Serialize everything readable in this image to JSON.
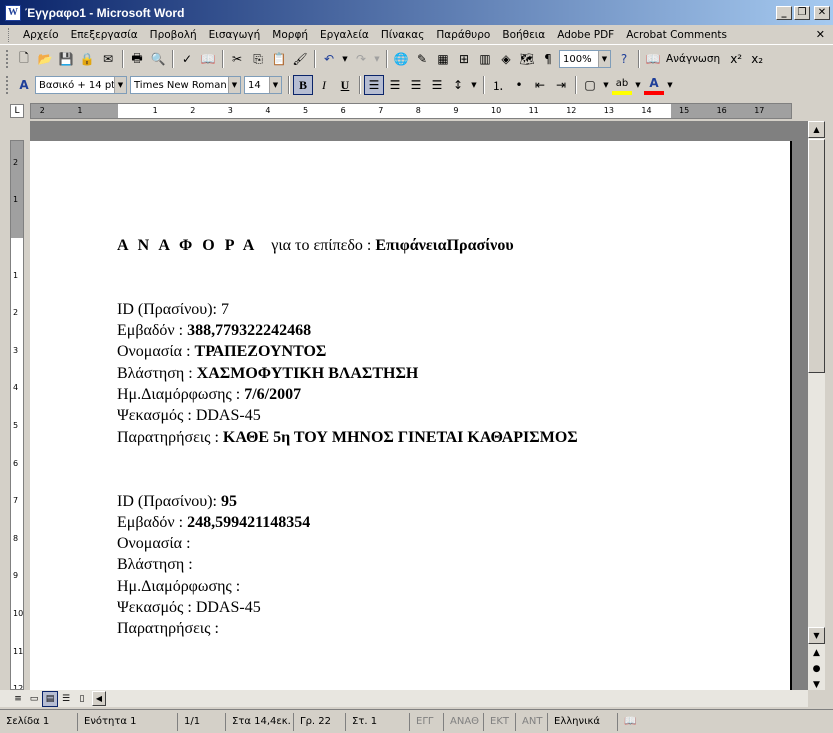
{
  "window": {
    "title": "Έγγραφο1 - Microsoft Word",
    "app_icon": "W"
  },
  "menu": {
    "items": [
      "Αρχείο",
      "Επεξεργασία",
      "Προβολή",
      "Εισαγωγή",
      "Μορφή",
      "Εργαλεία",
      "Πίνακας",
      "Παράθυρο",
      "Βοήθεια",
      "Adobe PDF",
      "Acrobat Comments"
    ]
  },
  "toolbar_standard": {
    "zoom": "100%",
    "reading_label": "Ανάγνωση"
  },
  "toolbar_formatting": {
    "style": "Βασικό + 14 pt,",
    "font": "Times New Roman",
    "size": "14",
    "bold": "B",
    "italic": "I",
    "underline": "U",
    "highlight_color": "#ffff00",
    "font_color": "#ff0000"
  },
  "ruler": {
    "h_numbers": [
      "2",
      "1",
      "1",
      "2",
      "3",
      "4",
      "5",
      "6",
      "7",
      "8",
      "9",
      "10",
      "11",
      "12",
      "13",
      "14",
      "15",
      "16",
      "17"
    ],
    "v_numbers": [
      "2",
      "1",
      "1",
      "2",
      "3",
      "4",
      "5",
      "6",
      "7",
      "8",
      "9",
      "10",
      "11",
      "12"
    ]
  },
  "document": {
    "heading_spaced": "Α Ν Α Φ Ο Ρ Α",
    "heading_text": "για το επίπεδο :",
    "heading_layer": "ΕπιφάνειαΠρασίνου",
    "records": [
      {
        "id_label": "ID (Πρασίνου): ",
        "id_value": "7",
        "area_label": "Εμβαδόν : ",
        "area_value": "388,779322242468",
        "name_label": "Ονομασία : ",
        "name_value": "ΤΡΑΠΕΖΟΥΝΤΟΣ",
        "veg_label": "Βλάστηση : ",
        "veg_value": "ΧΑΣΜΟΦΥΤΙΚΗ ΒΛΑΣΤΗΣΗ",
        "date_label": "Ημ.Διαμόρφωσης : ",
        "date_value": "7/6/2007",
        "spray_label": "Ψεκασμός : ",
        "spray_value": "DDAS-45",
        "notes_label": "Παρατηρήσεις : ",
        "notes_value": "ΚΑΘΕ 5η ΤΟΥ ΜΗΝΟΣ ΓΙΝΕΤΑΙ ΚΑΘΑΡΙΣΜΟΣ"
      },
      {
        "id_label": "ID (Πρασίνου): ",
        "id_value": "95",
        "area_label": "Εμβαδόν : ",
        "area_value": "248,599421148354",
        "name_label": "Ονομασία : ",
        "name_value": "",
        "veg_label": "Βλάστηση : ",
        "veg_value": "",
        "date_label": "Ημ.Διαμόρφωσης : ",
        "date_value": "",
        "spray_label": "Ψεκασμός : ",
        "spray_value": "DDAS-45",
        "notes_label": "Παρατηρήσεις : ",
        "notes_value": ""
      }
    ]
  },
  "statusbar": {
    "page": "Σελίδα 1",
    "section": "Ενότητα 1",
    "pages": "1/1",
    "at": "Στα 14,4εκ.",
    "line": "Γρ. 22",
    "col": "Στ. 1",
    "rec": "ΕΓΓ",
    "trk": "ΑΝΑΘ",
    "ext": "ΕΚΤ",
    "ovr": "ΑΝΤ",
    "language": "Ελληνικά"
  }
}
